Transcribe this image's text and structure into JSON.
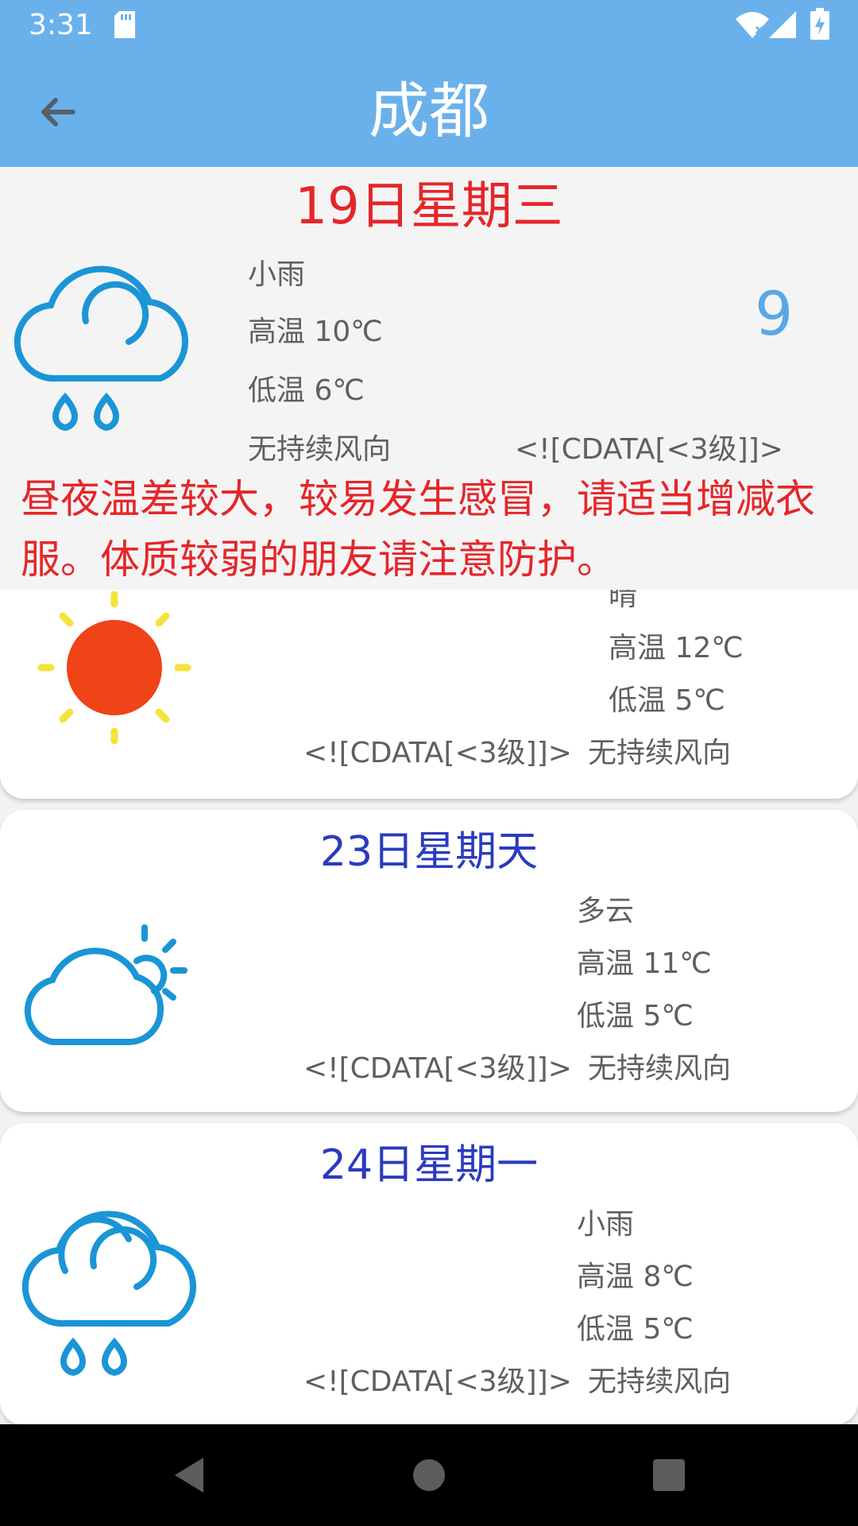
{
  "status_bar": {
    "time": "3:31"
  },
  "app_bar": {
    "title": "成都"
  },
  "today": {
    "date": "19日星期三",
    "condition": "小雨",
    "high": "高温 10℃",
    "low": "低温 6℃",
    "wind_direction": "无持续风向",
    "wind_level": "<![CDATA[<3级]]>",
    "current_temp": "9",
    "tip": "昼夜温差较大，较易发生感冒，请适当增减衣服。体质较弱的朋友请注意防护。",
    "icon": "rain-cloud-icon"
  },
  "forecast": [
    {
      "condition": "晴",
      "high": "高温 12℃",
      "low": "低温 5℃",
      "wind_level": "<![CDATA[<3级]]>",
      "wind_direction": "无持续风向",
      "icon": "sun-icon"
    },
    {
      "date": "23日星期天",
      "condition": "多云",
      "high": "高温 11℃",
      "low": "低温 5℃",
      "wind_level": "<![CDATA[<3级]]>",
      "wind_direction": "无持续风向",
      "icon": "partly-cloudy-icon"
    },
    {
      "date": "24日星期一",
      "condition": "小雨",
      "high": "高温 8℃",
      "low": "低温 5℃",
      "wind_level": "<![CDATA[<3级]]>",
      "wind_direction": "无持续风向",
      "icon": "rain-cloud-icon"
    }
  ],
  "colors": {
    "app_bar": "#6ab1ec",
    "today_accent": "#e5262a",
    "date_blue": "#2b3bbd",
    "temp_blue": "#5aa7e8",
    "icon_blue": "#1a95d6",
    "sun_core": "#ef4318",
    "sun_rays": "#f5e33a"
  }
}
